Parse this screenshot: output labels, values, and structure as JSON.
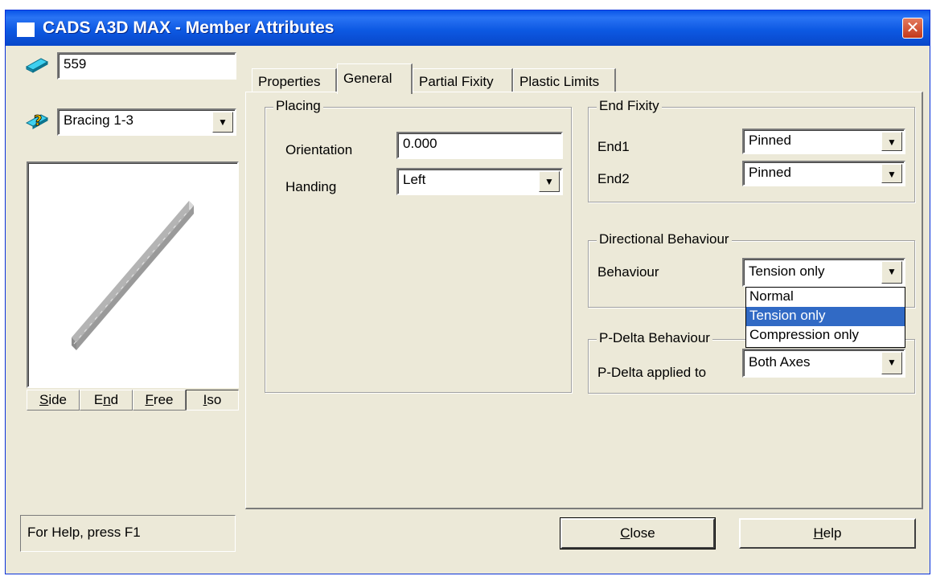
{
  "window": {
    "title": "CADS A3D MAX - Member Attributes",
    "close_glyph": "✕"
  },
  "member": {
    "id": "559",
    "type": "Bracing 1-3"
  },
  "view_buttons": [
    {
      "key": "S",
      "rest": "ide"
    },
    {
      "key": "",
      "pre": "E",
      "key2": "n",
      "rest": "d"
    },
    {
      "key": "F",
      "rest": "ree"
    },
    {
      "key": "I",
      "rest": "so"
    }
  ],
  "tabs": [
    "Properties",
    "General",
    "Partial Fixity",
    "Plastic Limits"
  ],
  "active_tab": "General",
  "placing": {
    "title": "Placing",
    "orientation_label": "Orientation",
    "orientation_value": "0.000",
    "handing_label": "Handing",
    "handing_value": "Left"
  },
  "end_fixity": {
    "title": "End Fixity",
    "end1_label": "End1",
    "end1_value": "Pinned",
    "end2_label": "End2",
    "end2_value": "Pinned"
  },
  "directional": {
    "title": "Directional Behaviour",
    "behaviour_label": "Behaviour",
    "behaviour_value": "Tension only",
    "options": [
      "Normal",
      "Tension only",
      "Compression only"
    ],
    "selected_option": "Tension only"
  },
  "pdelta": {
    "title": "P-Delta Behaviour",
    "label": "P-Delta applied to",
    "value": "Both Axes"
  },
  "status": "For Help, press F1",
  "buttons": {
    "close_key": "C",
    "close_rest": "lose",
    "help_key": "H",
    "help_rest": "elp"
  },
  "colors": {
    "selection": "#316ac5",
    "dialog_bg": "#ece9d8",
    "titlebar": "#0a56e8"
  }
}
